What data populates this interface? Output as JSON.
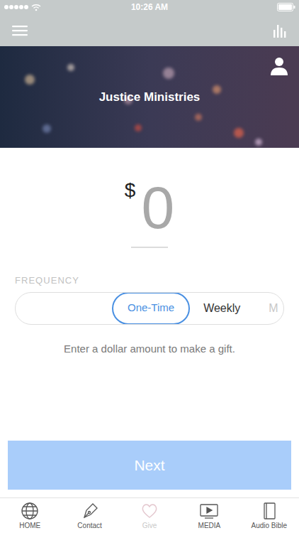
{
  "status_bar": {
    "time": "10:26 AM"
  },
  "header": {
    "title": "Justice Ministries"
  },
  "gift": {
    "currency": "$",
    "amount": "0",
    "frequency_label": "FREQUENCY",
    "frequencies": [
      {
        "label": "One-Time",
        "selected": true
      },
      {
        "label": "Weekly",
        "selected": false
      },
      {
        "label": "M",
        "selected": false
      }
    ],
    "hint": "Enter a dollar amount to make a gift.",
    "next": {
      "label": "Next",
      "disabled": true
    }
  },
  "tab_bar": [
    {
      "label": "HOME",
      "kind": "globe",
      "selected": false
    },
    {
      "label": "Contact",
      "kind": "pen",
      "selected": false
    },
    {
      "label": "Give",
      "kind": "heart",
      "selected": true
    },
    {
      "label": "MEDIA",
      "kind": "media",
      "selected": false
    },
    {
      "label": "Audio Bible",
      "kind": "book",
      "selected": false
    }
  ]
}
